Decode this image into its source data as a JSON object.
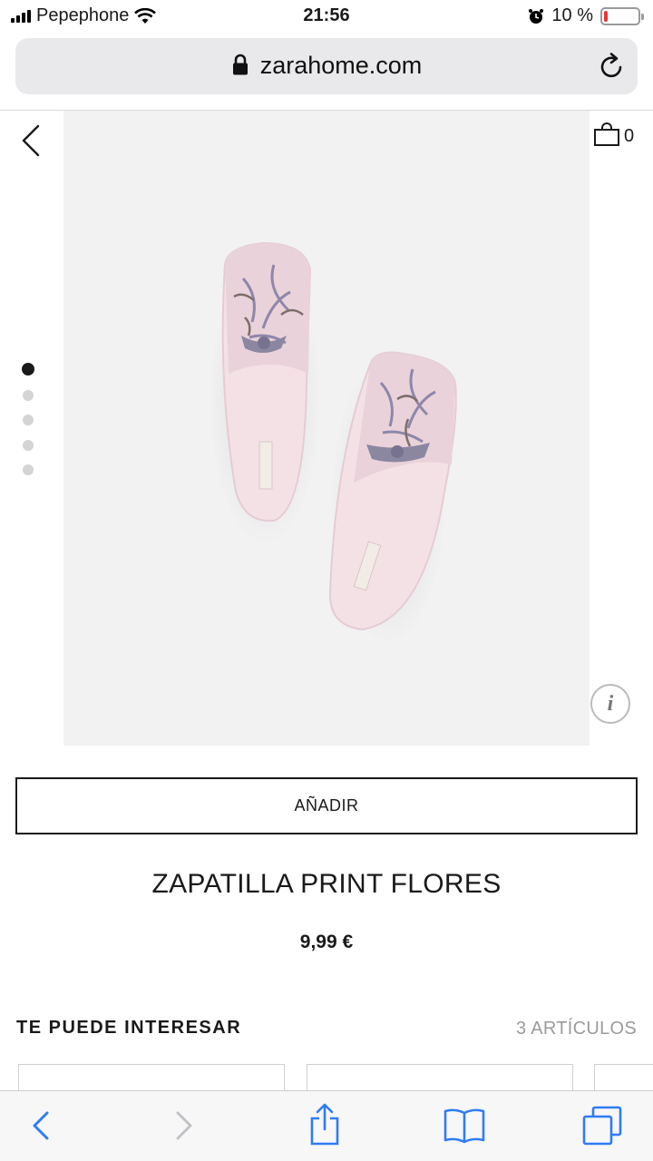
{
  "status_bar": {
    "carrier": "Pepephone",
    "time": "21:56",
    "battery": "10 %",
    "battery_level": 0.1
  },
  "browser": {
    "url": "zarahome.com"
  },
  "header": {
    "cart_count": "0"
  },
  "gallery": {
    "image_count": 5,
    "active_index": 0,
    "accent": "#e4c9d3"
  },
  "product": {
    "add_label": "AÑADIR",
    "name": "ZAPATILLA PRINT FLORES",
    "price": "9,99 €"
  },
  "recommendations": {
    "title": "TE PUEDE INTERESAR",
    "count": "3 ARTÍCULOS"
  },
  "colors": {
    "ios_blue": "#2f7cf6",
    "text": "#1a1a1a",
    "muted": "#9b9b9b"
  }
}
